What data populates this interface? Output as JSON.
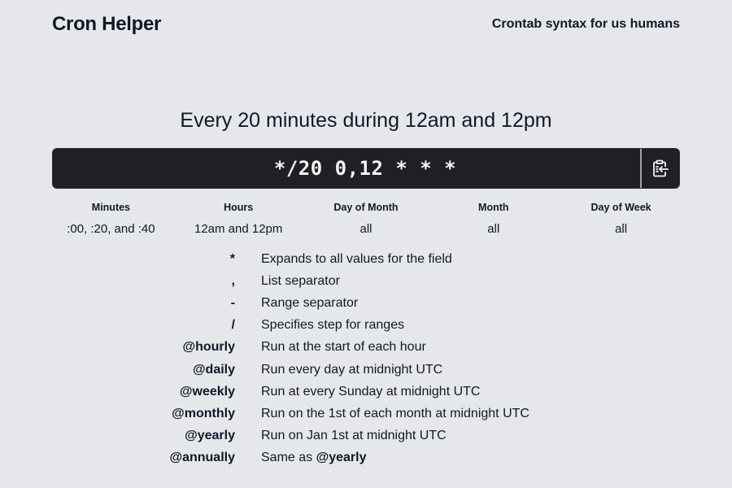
{
  "header": {
    "logo": "Cron Helper",
    "tagline": "Crontab syntax for us humans"
  },
  "description": "Every 20 minutes during 12am and 12pm",
  "expression": {
    "value": "*/20 0,12 * * *",
    "copy_icon": "clipboard-copy-icon"
  },
  "fields": [
    {
      "label": "Minutes",
      "value": ":00, :20, and :40"
    },
    {
      "label": "Hours",
      "value": "12am and 12pm"
    },
    {
      "label": "Day of Month",
      "value": "all"
    },
    {
      "label": "Month",
      "value": "all"
    },
    {
      "label": "Day of Week",
      "value": "all"
    }
  ],
  "legend": [
    {
      "key": "*",
      "desc": "Expands to all values for the field"
    },
    {
      "key": ",",
      "desc": "List separator"
    },
    {
      "key": "-",
      "desc": "Range separator"
    },
    {
      "key": "/",
      "desc": "Specifies step for ranges"
    },
    {
      "key": "@hourly",
      "desc": "Run at the start of each hour"
    },
    {
      "key": "@daily",
      "desc": "Run every day at midnight UTC"
    },
    {
      "key": "@weekly",
      "desc": "Run at every Sunday at midnight UTC"
    },
    {
      "key": "@monthly",
      "desc": "Run on the 1st of each month at midnight UTC"
    },
    {
      "key": "@yearly",
      "desc": "Run on Jan 1st at midnight UTC"
    },
    {
      "key": "@annually",
      "desc": "Same as",
      "desc_bold": "@yearly"
    }
  ],
  "colors": {
    "background": "#e5e7eb",
    "bar": "#1f2023",
    "text": "#111827"
  }
}
